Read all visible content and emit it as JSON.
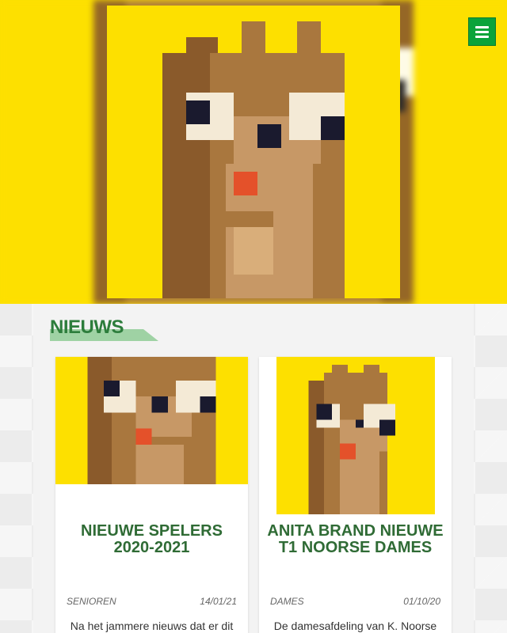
{
  "header": {
    "logo_name": "pixel squirrel mascot",
    "menu_icon": "hamburger-icon",
    "colors": {
      "yellow": "#fde000",
      "green": "#0aa33a"
    }
  },
  "news": {
    "section_title": "NIEUWS",
    "cards": [
      {
        "title": "NIEUWE SPELERS 2020-2021",
        "category": "SENIOREN",
        "date": "14/01/21",
        "excerpt": "Na het jammere nieuws dat er dit"
      },
      {
        "title": "ANITA BRAND NIEUWE T1 NOORSE DAMES",
        "category": "DAMES",
        "date": "01/10/20",
        "excerpt": "De damesafdeling van K. Noorse"
      }
    ]
  },
  "colors": {
    "accent": "#2d7d3c",
    "underline": "#9fd2a4",
    "background": "#e9e9e9"
  }
}
